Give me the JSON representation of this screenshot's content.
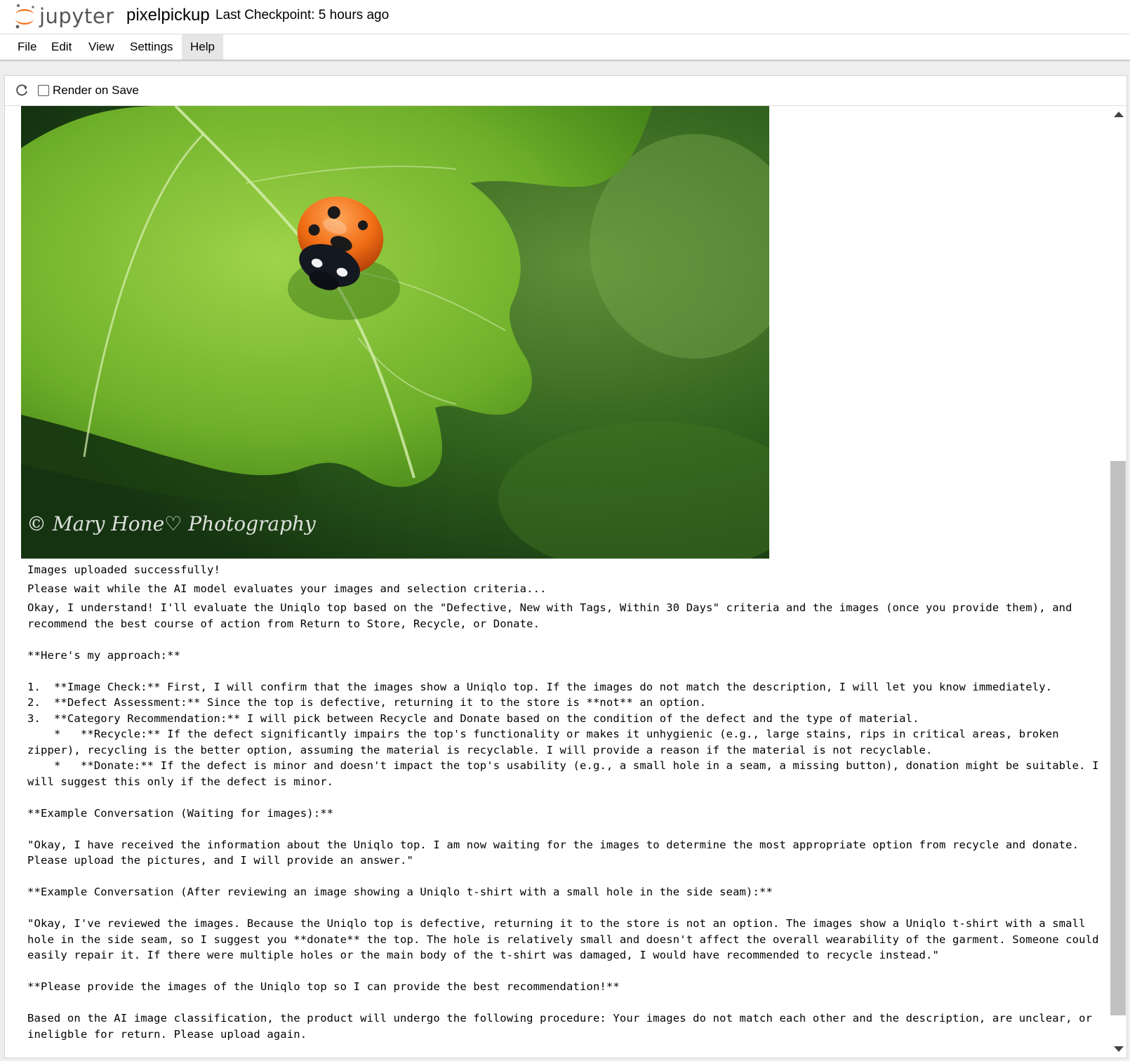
{
  "header": {
    "logo_text": "jupyter",
    "notebook_name": "pixelpickup",
    "checkpoint": "Last Checkpoint: 5 hours ago"
  },
  "menu": {
    "items": [
      {
        "label": "File"
      },
      {
        "label": "Edit"
      },
      {
        "label": "View"
      },
      {
        "label": "Settings"
      },
      {
        "label": "Help"
      }
    ]
  },
  "toolbar": {
    "render_on_save_label": "Render on Save",
    "render_on_save_checked": false
  },
  "output": {
    "image": {
      "icon": "ladybug-on-leaf-photo",
      "watermark": "© Mary Hone♡ Photography"
    },
    "line1": "Images uploaded successfully!",
    "line2": "Please wait while the AI model evaluates your images and selection criteria...",
    "response": "Okay, I understand! I'll evaluate the Uniqlo top based on the \"Defective, New with Tags, Within 30 Days\" criteria and the images (once you provide them), and recommend the best course of action from Return to Store, Recycle, or Donate.\n\n**Here's my approach:**\n\n1.  **Image Check:** First, I will confirm that the images show a Uniqlo top. If the images do not match the description, I will let you know immediately.\n2.  **Defect Assessment:** Since the top is defective, returning it to the store is **not** an option.\n3.  **Category Recommendation:** I will pick between Recycle and Donate based on the condition of the defect and the type of material.\n    *   **Recycle:** If the defect significantly impairs the top's functionality or makes it unhygienic (e.g., large stains, rips in critical areas, broken zipper), recycling is the better option, assuming the material is recyclable. I will provide a reason if the material is not recyclable.\n    *   **Donate:** If the defect is minor and doesn't impact the top's usability (e.g., a small hole in a seam, a missing button), donation might be suitable. I will suggest this only if the defect is minor.\n\n**Example Conversation (Waiting for images):**\n\n\"Okay, I have received the information about the Uniqlo top. I am now waiting for the images to determine the most appropriate option from recycle and donate. Please upload the pictures, and I will provide an answer.\"\n\n**Example Conversation (After reviewing an image showing a Uniqlo t-shirt with a small hole in the side seam):**\n\n\"Okay, I've reviewed the images. Because the Uniqlo top is defective, returning it to the store is not an option. The images show a Uniqlo t-shirt with a small hole in the side seam, so I suggest you **donate** the top. The hole is relatively small and doesn't affect the overall wearability of the garment. Someone could easily repair it. If there were multiple holes or the main body of the t-shirt was damaged, I would have recommended to recycle instead.\"\n\n**Please provide the images of the Uniqlo top so I can provide the best recommendation!**\n\nBased on the AI image classification, the product will undergo the following procedure: Your images do not match each other and the description, are unclear, or ineligble for return. Please upload again."
  },
  "colors": {
    "jupyter_orange": "#f37726",
    "menu_active_bg": "#e6e6e6",
    "scroll_thumb": "#c1c1c1"
  }
}
